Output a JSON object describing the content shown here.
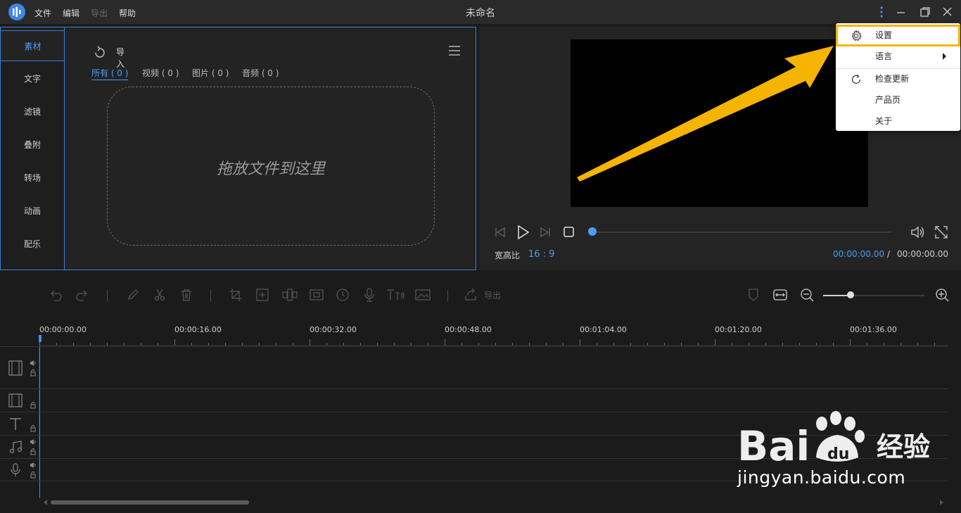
{
  "titlebar": {
    "menus": [
      "文件",
      "编辑",
      "导出",
      "帮助"
    ],
    "title": "未命名"
  },
  "media_panel": {
    "side_tabs": [
      "素材",
      "文字",
      "滤镜",
      "叠附",
      "转场",
      "动画",
      "配乐"
    ],
    "active_tab": "素材",
    "import_label": "导入",
    "filters": [
      "所有 ( 0 )",
      "视频 ( 0 )",
      "图片 ( 0 )",
      "音频 ( 0 )"
    ],
    "drop_text": "拖放文件到这里"
  },
  "preview": {
    "aspect_label": "宽高比",
    "aspect_value": "16 : 9",
    "time_current": "00:00:00.00",
    "time_separator": "/",
    "time_total": "00:00:00.00"
  },
  "dropdown": {
    "items": [
      "设置",
      "语言",
      "检查更新",
      "产品页",
      "关于"
    ]
  },
  "timeline": {
    "export_label": "导出",
    "ruler_labels": [
      "00:00:00.00",
      "00:00:16.00",
      "00:00:32.00",
      "00:00:48.00",
      "00:01:04.00",
      "00:01:20.00",
      "00:01:36.00"
    ]
  },
  "watermark": {
    "brand": "Bai",
    "brand_cn": "经验",
    "url": "jingyan.baidu.com"
  },
  "colors": {
    "accent": "#4e9bf5",
    "highlight": "#f5b400",
    "background": "#1b1b1b"
  }
}
